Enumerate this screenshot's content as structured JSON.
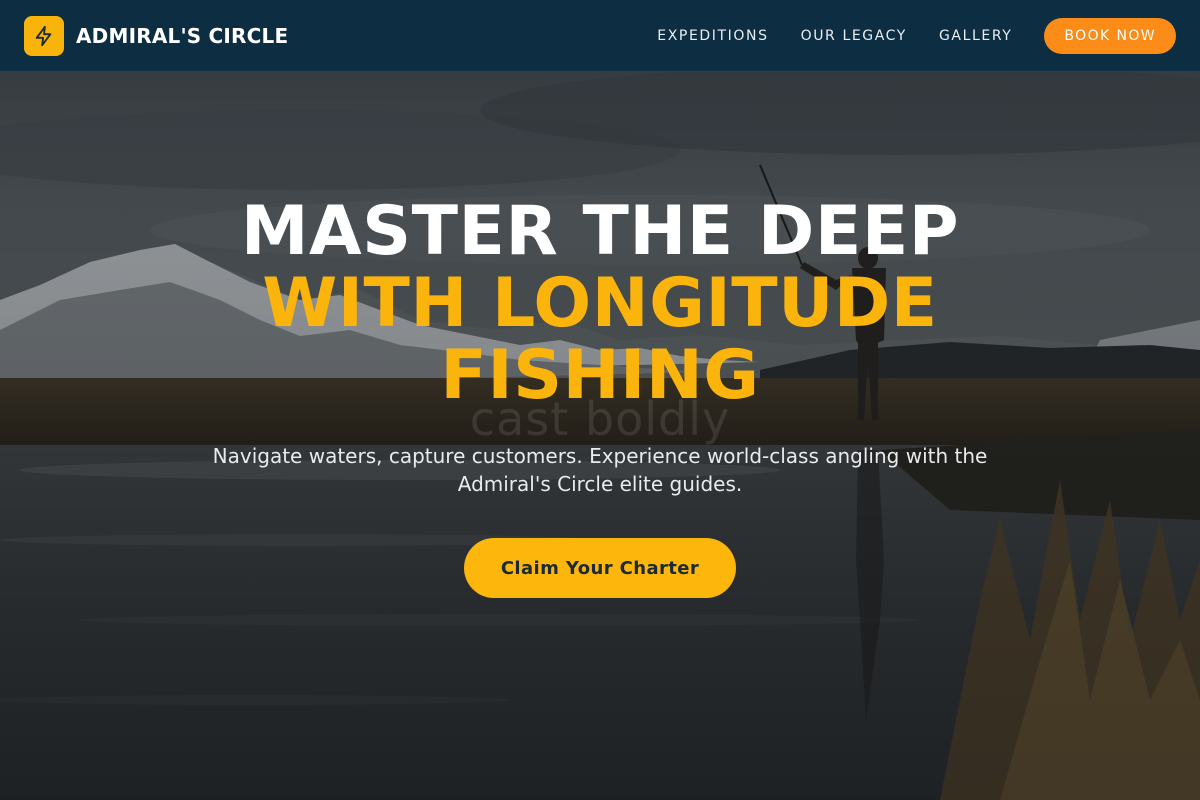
{
  "nav": {
    "brand_name": "ADMIRAL'S CIRCLE",
    "brand_icon": "lightning-bolt-icon",
    "links": [
      {
        "label": "EXPEDITIONS"
      },
      {
        "label": "OUR LEGACY"
      },
      {
        "label": "GALLERY"
      }
    ],
    "cta_label": "BOOK NOW"
  },
  "hero": {
    "headline_line1": "MASTER THE DEEP",
    "headline_line2": "WITH LONGITUDE",
    "headline_line3": "FISHING",
    "watermark_text": "cast boldly",
    "subtitle": "Navigate waters, capture customers. Experience world-class angling with the Admiral's Circle elite guides.",
    "cta_label": "Claim Your Charter",
    "background_scene": "angler fly fishing in river at dusk with snowy mountains"
  },
  "colors": {
    "nav_bg": "#0b2d44",
    "brand_accent": "#f8b40a",
    "book_now": "#fb8c17",
    "headline_gold": "#fbb40b",
    "cta_gold": "#fcb60c"
  }
}
